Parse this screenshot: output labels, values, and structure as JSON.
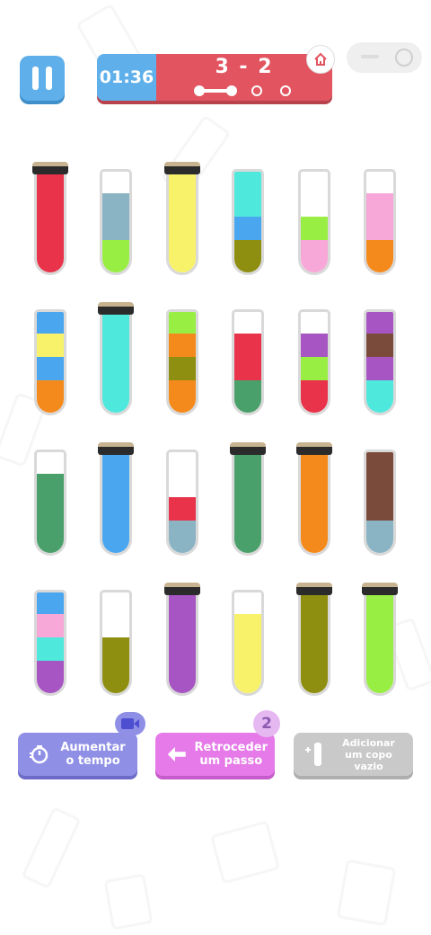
{
  "timer": "01:36",
  "level": "3 - 2",
  "stage_progress": {
    "current": 1,
    "total": 3
  },
  "icons": {
    "pause": "pause-icon",
    "home": "home-icon",
    "toggle": "toggle-icon",
    "video": "video-camera-icon",
    "stopwatch": "stopwatch-icon",
    "back_arrow": "arrow-left-icon",
    "add_tube": "add-tube-icon"
  },
  "tubes": [
    {
      "colors": [
        "#e8334a",
        "#e8334a",
        "#e8334a",
        "#e8334a"
      ],
      "sealed": true
    },
    {
      "colors": [
        "#99ee44",
        "#8ab4c4",
        "#8ab4c4"
      ],
      "sealed": false
    },
    {
      "colors": [
        "#f7f26a",
        "#f7f26a",
        "#f7f26a",
        "#f7f26a"
      ],
      "sealed": true
    },
    {
      "colors": [
        "#8e8e10",
        "#4aa6ef",
        "#4fe8dc",
        "#4fe8dc"
      ],
      "sealed": false
    },
    {
      "colors": [
        "#f7a8d8",
        "#99ee44"
      ],
      "sealed": false
    },
    {
      "colors": [
        "#f58a1c",
        "#f7a8d8",
        "#f7a8d8"
      ],
      "sealed": false
    },
    {
      "colors": [
        "#f58a1c",
        "#4aa6ef",
        "#f7f26a",
        "#4aa6ef"
      ],
      "sealed": false
    },
    {
      "colors": [
        "#4fe8dc",
        "#4fe8dc",
        "#4fe8dc",
        "#4fe8dc"
      ],
      "sealed": true
    },
    {
      "colors": [
        "#f58a1c",
        "#8e8e10",
        "#f58a1c",
        "#99ee44"
      ],
      "sealed": false
    },
    {
      "colors": [
        "#4aa06a",
        "#e8334a",
        "#e8334a"
      ],
      "sealed": false
    },
    {
      "colors": [
        "#e8334a",
        "#99ee44",
        "#a655c2"
      ],
      "sealed": false
    },
    {
      "colors": [
        "#4fe8dc",
        "#a655c2",
        "#7a4a3a",
        "#a655c2"
      ],
      "sealed": false
    },
    {
      "colors": [
        "#4aa06a",
        "#4aa06a",
        "#4aa06a"
      ],
      "sealed": false
    },
    {
      "colors": [
        "#4aa6ef",
        "#4aa6ef",
        "#4aa6ef",
        "#4aa6ef"
      ],
      "sealed": true
    },
    {
      "colors": [
        "#8ab4c4",
        "#e8334a"
      ],
      "sealed": false
    },
    {
      "colors": [
        "#4aa06a",
        "#4aa06a",
        "#4aa06a",
        "#4aa06a"
      ],
      "sealed": true
    },
    {
      "colors": [
        "#f58a1c",
        "#f58a1c",
        "#f58a1c",
        "#f58a1c"
      ],
      "sealed": true
    },
    {
      "colors": [
        "#8ab4c4",
        "#7a4a3a",
        "#7a4a3a",
        "#7a4a3a"
      ],
      "sealed": false
    },
    {
      "colors": [
        "#a655c2",
        "#4fe8dc",
        "#f7a8d8",
        "#4aa6ef"
      ],
      "sealed": false
    },
    {
      "colors": [
        "#8e8e10",
        "#8e8e10"
      ],
      "sealed": false
    },
    {
      "colors": [
        "#a655c2",
        "#a655c2",
        "#a655c2",
        "#a655c2"
      ],
      "sealed": true
    },
    {
      "colors": [
        "#f7f26a",
        "#f7f26a",
        "#f7f26a"
      ],
      "sealed": false
    },
    {
      "colors": [
        "#8e8e10",
        "#8e8e10",
        "#8e8e10",
        "#8e8e10"
      ],
      "sealed": true
    },
    {
      "colors": [
        "#99ee44",
        "#99ee44",
        "#99ee44",
        "#99ee44"
      ],
      "sealed": true
    }
  ],
  "buttons": {
    "time_line1": "Aumentar",
    "time_line2": "o tempo",
    "undo_line1": "Retroceder",
    "undo_line2": "um passo",
    "undo_count": "2",
    "add_line1": "Adicionar",
    "add_line2": "um copo vazio"
  }
}
